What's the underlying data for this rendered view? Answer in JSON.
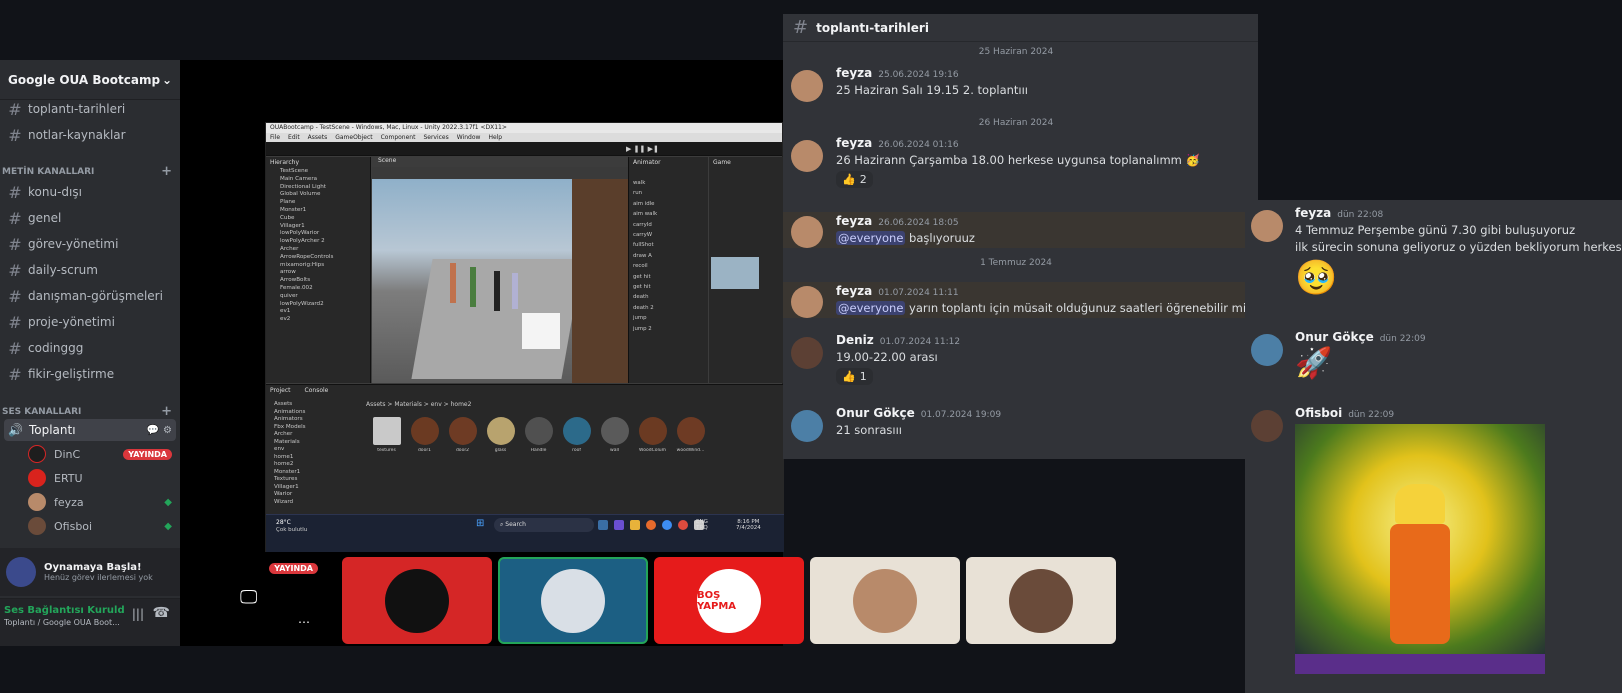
{
  "sidebar": {
    "server_name": "Google OUA Bootcamp",
    "top_channels": [
      "toplantı-tarihleri",
      "notlar-kaynaklar"
    ],
    "text_category": "METİN KANALLARI",
    "text_channels": [
      "konu-dışı",
      "genel",
      "görev-yönetimi",
      "daily-scrum",
      "danışman-görüşmeleri",
      "proje-yönetimi",
      "codinggg",
      "fikir-geliştirme"
    ],
    "voice_category": "SES KANALLARI",
    "voice_channel": "Toplantı",
    "voice_users": [
      {
        "name": "DinC",
        "badge": "YAYINDA",
        "color": "#1e1e1e"
      },
      {
        "name": "ERTU",
        "color": "#d9231d"
      },
      {
        "name": "feyza",
        "color": "#b88a6a"
      },
      {
        "name": "Ofisboi",
        "color": "#6a4b3a"
      }
    ],
    "activity": {
      "title": "Oynamaya Başla!",
      "subtitle": "Henüz görev ilerlemesi yok"
    },
    "connection": {
      "status": "Ses Bağlantısı Kuruld",
      "location": "Toplantı / Google OUA Boot..."
    }
  },
  "stage": {
    "live_badge": "YAYINDA",
    "unity": {
      "title": "OUABootcamp - TestScene - Windows, Mac, Linux - Unity 2022.3.17f1 <DX11>",
      "menu": [
        "File",
        "Edit",
        "Assets",
        "GameObject",
        "Component",
        "Services",
        "Window",
        "Help"
      ],
      "hierarchy_title": "Hierarchy",
      "scene_tab": "Scene",
      "animator_tab": "Animator",
      "game_tab": "Game",
      "hierarchy_items": [
        "TestScene",
        "Main Camera",
        "Directional Light",
        "Global Volume",
        "Plane",
        "Monster1",
        "Cube",
        "Villager1",
        "lowPolyWarior",
        "lowPolyArcher 2",
        "Archer",
        "ArrowRopeControls",
        "mixamorig:Hips",
        "arrow",
        "ArrowBolts",
        "Female.002",
        "quiver",
        "lowPolyWizard2",
        "ev1",
        "ev2"
      ],
      "animator_params": [
        "walk",
        "run",
        "aim idle",
        "aim walk",
        "carryId",
        "carryW",
        "fullShot",
        "draw A",
        "recoil",
        "get hit",
        "get hit",
        "death",
        "death 2",
        "jump",
        "jump 2"
      ],
      "project_tab": "Project",
      "console_tab": "Console",
      "path": "Assets > Materials > env > home2",
      "folders": [
        "Assets",
        "Animations",
        "Animators",
        "Fbx Models",
        "Archer",
        "Materials",
        "env",
        "home1",
        "home2",
        "Monster1",
        "Textures",
        "Villager1",
        "Warior",
        "Wizard"
      ],
      "assets": [
        "textures",
        "door1",
        "door2",
        "glass",
        "Handle",
        "roof",
        "wall",
        "WoodColum",
        "woodWind..."
      ],
      "taskbar": {
        "weather": "28°C",
        "weather_sub": "Çok bulutlu",
        "search": "Search",
        "lang": "ENG",
        "lang2": "TRQ",
        "time": "8:16 PM",
        "date": "7/4/2024"
      }
    },
    "tiles": [
      {
        "label": "",
        "color": "#d52626"
      },
      {
        "label": "",
        "color": "#1c5f83"
      },
      {
        "label": "BOŞ YAPMA",
        "color": "#e61b1b"
      },
      {
        "label": "",
        "color": "#e8e1d6"
      },
      {
        "label": "",
        "color": "#e8e1d6"
      }
    ]
  },
  "chat1": {
    "channel": "toplantı-tarihleri",
    "dates": [
      "25 Haziran 2024",
      "26 Haziran 2024",
      "1 Temmuz 2024"
    ],
    "messages": [
      {
        "user": "feyza",
        "time": "25.06.2024 19:16",
        "text": "25 Haziran Salı 19.15 2. toplantııı"
      },
      {
        "user": "feyza",
        "time": "26.06.2024 01:16",
        "text": "26 Hazirann Çarşamba 18.00 herkese uygunsa toplanalımm",
        "reaction": "2"
      },
      {
        "user": "feyza",
        "time": "26.06.2024 18:05",
        "mention": "@everyone",
        "text": "başlıyoruuz"
      },
      {
        "user": "feyza",
        "time": "01.07.2024 11:11",
        "mention": "@everyone",
        "text": "yarın toplantı için müsait olduğunuz saatleri öğrenebilir miyimm"
      },
      {
        "user": "Deniz",
        "time": "01.07.2024 11:12",
        "text": "19.00-22.00 arası",
        "reaction": "1"
      },
      {
        "user": "Onur Gökçe",
        "time": "01.07.2024 19:09",
        "text": "21 sonrasııı"
      }
    ]
  },
  "chat2": {
    "messages": [
      {
        "user": "feyza",
        "time": "dün 22:08",
        "line1": "4 Temmuz Perşembe günü 7.30 gibi buluşuyoruz",
        "line2": "ilk sürecin sonuna geliyoruz o yüzden bekliyorum herkesi",
        "emoji": "🥹"
      },
      {
        "user": "Onur Gökçe",
        "time": "dün 22:09",
        "emoji": "🚀"
      },
      {
        "user": "Ofisboi",
        "time": "dün 22:09"
      }
    ]
  },
  "colors": {
    "accent": "#5865f2",
    "green": "#23a55a",
    "live": "#da373c"
  }
}
